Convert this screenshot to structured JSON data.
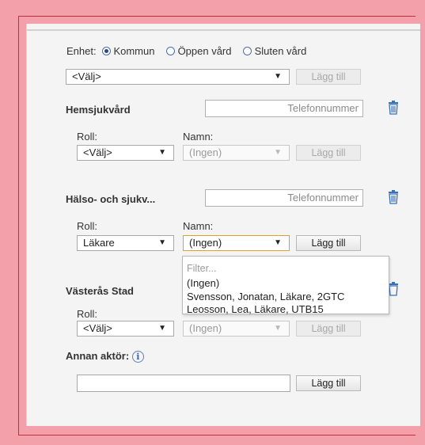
{
  "unit": {
    "label": "Enhet:",
    "options": [
      {
        "label": "Kommun",
        "selected": true
      },
      {
        "label": "Öppen vård",
        "selected": false
      },
      {
        "label": "Sluten vård",
        "selected": false
      }
    ],
    "select_value": "<Välj>",
    "add_label": "Lägg till"
  },
  "sections": [
    {
      "title": "Hemsjukvård",
      "phone_placeholder": "Telefonnummer",
      "role_label": "Roll:",
      "name_label": "Namn:",
      "role_value": "<Välj>",
      "name_value": "(Ingen)",
      "add_label": "Lägg till"
    },
    {
      "title": "Hälso- och sjukv...",
      "phone_placeholder": "Telefonnummer",
      "role_label": "Roll:",
      "name_label": "Namn:",
      "role_value": "Läkare",
      "name_value": "(Ingen)",
      "add_label": "Lägg till"
    },
    {
      "title": "Västerås Stad",
      "role_label": "Roll:",
      "role_value": "<Välj>",
      "name_value": "(Ingen)",
      "add_label": "Lägg till"
    }
  ],
  "dropdown": {
    "filter_placeholder": "Filter...",
    "options": [
      "(Ingen)",
      "Svensson, Jonatan, Läkare, 2GTC",
      "Leosson, Lea, Läkare, UTB15"
    ]
  },
  "other_actor": {
    "label": "Annan aktör:",
    "info_icon": "i",
    "add_label": "Lägg till"
  },
  "colors": {
    "background": "#f4a0aa",
    "panel": "#f4f4f4",
    "focus_border": "#e0a030",
    "radio": "#2b4a80",
    "trash": "#3a72b8"
  }
}
